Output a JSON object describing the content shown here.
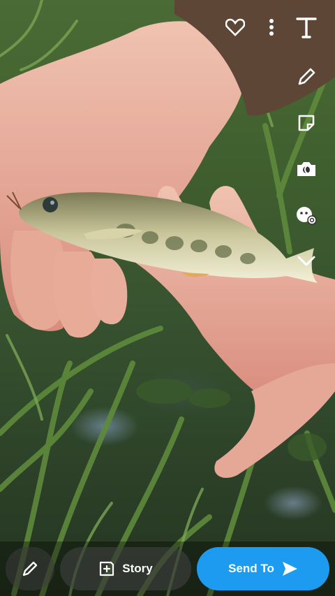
{
  "top_icons": {
    "favorite": "heart-icon",
    "more": "more-vertical-icon",
    "text": "text-tool-icon"
  },
  "rail_icons": [
    "pencil-icon",
    "sticker-icon",
    "lens-camera-icon",
    "emoji-icon",
    "chevron-down-icon"
  ],
  "bottom_bar": {
    "story_label": "Story",
    "send_label": "Send To"
  },
  "colors": {
    "send_button": "#1d9bf0",
    "icon": "#ffffff"
  }
}
